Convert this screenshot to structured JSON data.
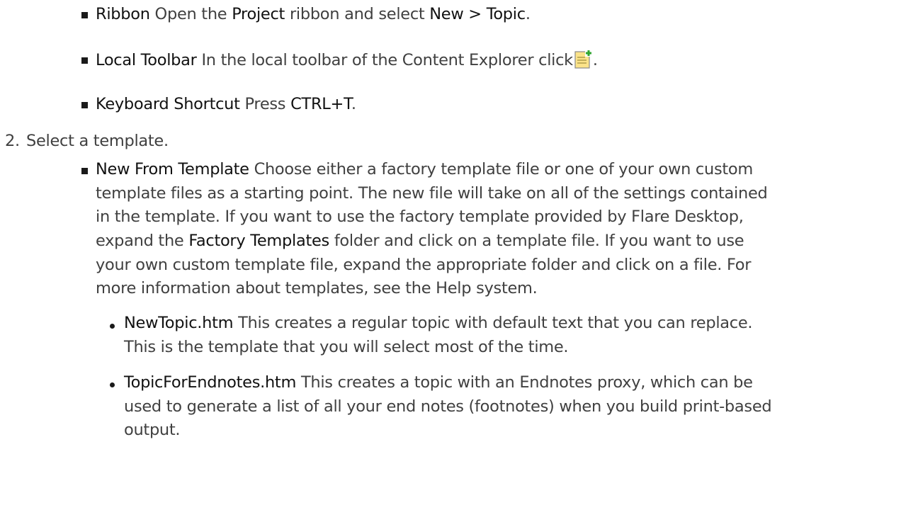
{
  "steps": {
    "ribbon": {
      "label": "Ribbon",
      "text_1": "Open the",
      "menu": "Project",
      "text_2": "ribbon and select",
      "command": "New > Topic",
      "end": "."
    },
    "local_toolbar": {
      "label": "Local Toolbar",
      "text": "In the local toolbar of the Content Explorer click",
      "icon": "new-topic-icon",
      "end": "."
    },
    "shortcut": {
      "label": "Keyboard Shortcut",
      "text": "Press",
      "keys": "CTRL+T",
      "end": "."
    },
    "step2": {
      "number": "2.",
      "text": "Select a template."
    },
    "new_from_template": {
      "label": "New From Template",
      "line1": "Choose either a factory template file or one of your own custom",
      "line2": "template files as a starting point. The new file will take on all of the settings contained",
      "line3": "in the template. If you want to use the factory template provided by Flare Desktop,",
      "line4_a": "expand the",
      "line4_bold": "Factory Templates",
      "line4_b": "folder and click on a template file. If you want to use",
      "line5": "your own custom template file, expand the appropriate folder and click on a file. For",
      "line6": "more information about templates, see the Help system."
    },
    "templates": [
      {
        "name": "NewTopic.htm",
        "line1": "This creates a regular topic with default text that you can replace.",
        "line2": "This is the template that you will select most of the time."
      },
      {
        "name": "TopicForEndnotes.htm",
        "line1": "This creates a topic with an Endnotes proxy, which can be",
        "line2": "used to generate a list of all your end notes (footnotes) when you build print-based",
        "line3": "output."
      }
    ]
  },
  "colors": {
    "text": "#404040",
    "bold": "#111111",
    "icon_page": "#fbe38a",
    "icon_plus": "#2fa52f"
  }
}
